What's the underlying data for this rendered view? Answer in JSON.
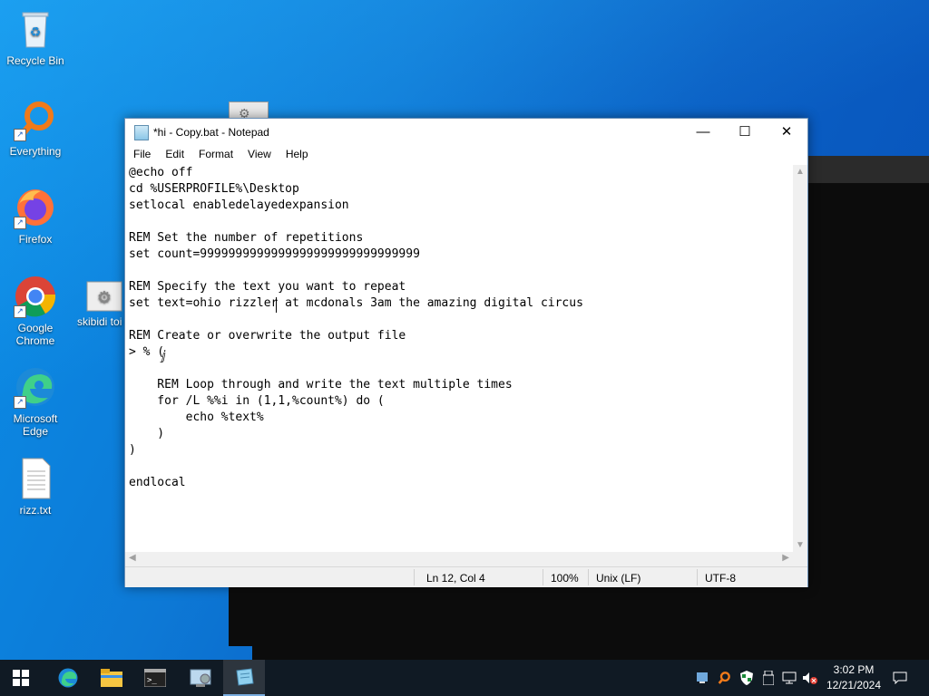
{
  "desktop": {
    "icons": [
      {
        "label": "Recycle Bin"
      },
      {
        "label": "Everything"
      },
      {
        "label": "Firefox"
      },
      {
        "label": "Google Chrome"
      },
      {
        "label": "skibidi toi creator.b"
      },
      {
        "label": "Microsoft Edge"
      },
      {
        "label": "rizz.txt"
      }
    ]
  },
  "notepad": {
    "title": "*hi - Copy.bat - Notepad",
    "menu": [
      "File",
      "Edit",
      "Format",
      "View",
      "Help"
    ],
    "lines": [
      "@echo off",
      "cd %USERPROFILE%\\Desktop",
      "setlocal enabledelayedexpansion",
      "",
      "REM Set the number of repetitions",
      "set count=9999999999999999999999999999999",
      "",
      "REM Specify the text you want to repeat",
      "set text=ohio rizzler at mcdonals 3am the amazing digital circus",
      "",
      "REM Create or overwrite the output file",
      "> % (",
      "",
      "    REM Loop through and write the text multiple times",
      "    for /L %%i in (1,1,%count%) do (",
      "        echo %text%",
      "    )",
      ")",
      "",
      "endlocal"
    ],
    "status": {
      "position": "Ln 12, Col 4",
      "zoom": "100%",
      "line_ending": "Unix (LF)",
      "encoding": "UTF-8"
    }
  },
  "taskbar": {
    "clock_time": "3:02 PM",
    "clock_date": "12/21/2024"
  },
  "colors": {
    "desktop_blue": "#0d79d6",
    "taskbar": "#101a24"
  }
}
